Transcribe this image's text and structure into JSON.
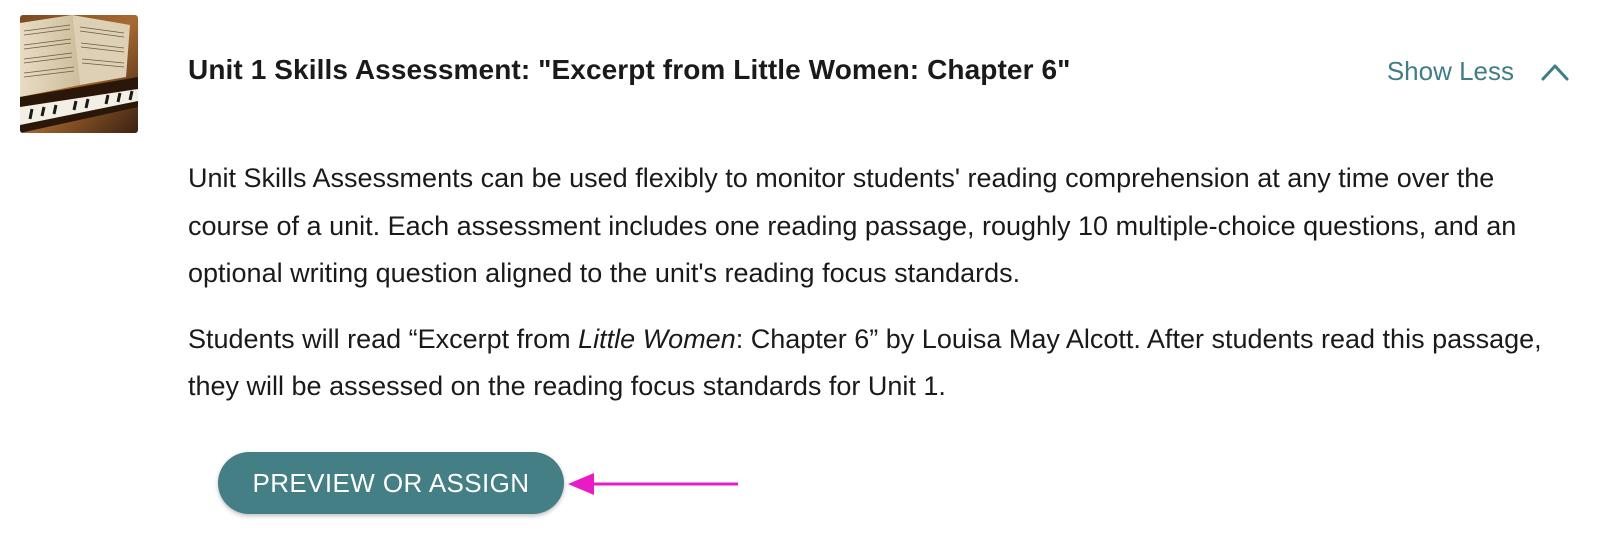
{
  "item": {
    "thumbnail_icon": "sheet-music-piano-image",
    "title": "Unit 1 Skills Assessment: \"Excerpt from Little Women: Chapter 6\"",
    "toggle_label": "Show Less",
    "toggle_icon": "chevron-up-icon",
    "description": {
      "paragraph1": "Unit Skills Assessments can be used flexibly to monitor students' reading comprehension at any time over the course of a unit. Each assessment includes one reading passage, roughly 10 multiple-choice questions, and an optional writing question aligned to the unit's reading focus standards.",
      "paragraph2_before": "Students will read “Excerpt from ",
      "paragraph2_italic": "Little Women",
      "paragraph2_after": ": Chapter 6” by Louisa May Alcott. After students read this passage, they will be assessed on the reading focus standards for Unit 1."
    },
    "button_label": "PREVIEW OR ASSIGN",
    "annotation_icon": "arrow-left-icon"
  },
  "colors": {
    "accent_teal": "#447f86",
    "link_teal": "#3f7e86",
    "annotation_magenta": "#e81cc4",
    "text": "#1a1a1a"
  }
}
